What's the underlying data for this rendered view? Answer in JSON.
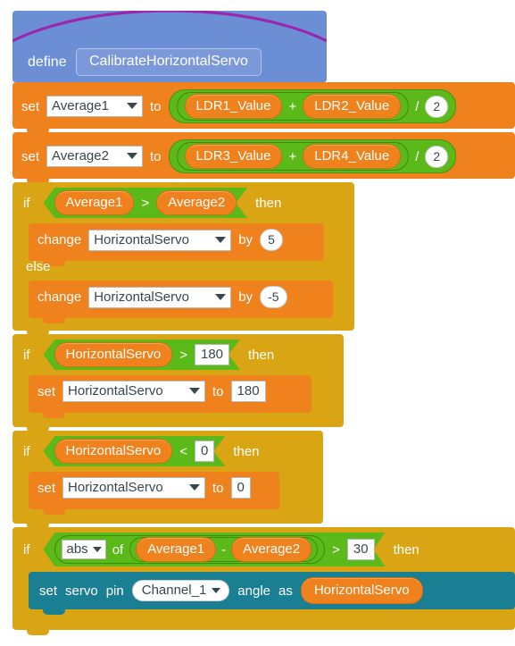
{
  "workspace": {
    "title": "CalibrateHorizontalServo procedure definition"
  },
  "colors": {
    "hat": "#6c8ed4",
    "hat_arc": "#9b27b0",
    "variable_orange": "#f0821e",
    "operator_green": "#5bb919",
    "control_gold": "#d9a514",
    "servo_teal": "#1a7f92",
    "field_white": "#ffffff",
    "field_text": "#37474f"
  },
  "define_block": {
    "keyword": "define",
    "procedure_name": "CalibrateHorizontalServo"
  },
  "set_average1": {
    "set_label": "set",
    "variable": "Average1",
    "to_label": "to",
    "operand_left": "LDR1_Value",
    "operator_add": "+",
    "operand_right": "LDR2_Value",
    "operator_divide": "/",
    "divisor": "2"
  },
  "set_average2": {
    "set_label": "set",
    "variable": "Average2",
    "to_label": "to",
    "operand_left": "LDR3_Value",
    "operator_add": "+",
    "operand_right": "LDR4_Value",
    "operator_divide": "/",
    "divisor": "2"
  },
  "if_compare_averages": {
    "if_label": "if",
    "then_label": "then",
    "else_label": "else",
    "cond_left": "Average1",
    "cond_operator": ">",
    "cond_right": "Average2",
    "then_body": {
      "change_label": "change",
      "variable": "HorizontalServo",
      "by_label": "by",
      "amount": "5"
    },
    "else_body": {
      "change_label": "change",
      "variable": "HorizontalServo",
      "by_label": "by",
      "amount": "-5"
    }
  },
  "if_upper_clamp": {
    "if_label": "if",
    "then_label": "then",
    "cond_left": "HorizontalServo",
    "cond_operator": ">",
    "cond_right": "180",
    "body": {
      "set_label": "set",
      "variable": "HorizontalServo",
      "to_label": "to",
      "value": "180"
    }
  },
  "if_lower_clamp": {
    "if_label": "if",
    "then_label": "then",
    "cond_left": "HorizontalServo",
    "cond_operator": "<",
    "cond_right": "0",
    "body": {
      "set_label": "set",
      "variable": "HorizontalServo",
      "to_label": "to",
      "value": "0"
    }
  },
  "if_threshold": {
    "if_label": "if",
    "then_label": "then",
    "math_function": "abs",
    "of_label": "of",
    "operand_left": "Average1",
    "operator_subtract": "-",
    "operand_right": "Average2",
    "cond_operator": ">",
    "cond_right": "30",
    "body": {
      "set_label": "set",
      "servo_label": "servo",
      "pin_label": "pin",
      "channel": "Channel_1",
      "angle_label": "angle",
      "as_label": "as",
      "value": "HorizontalServo"
    }
  }
}
